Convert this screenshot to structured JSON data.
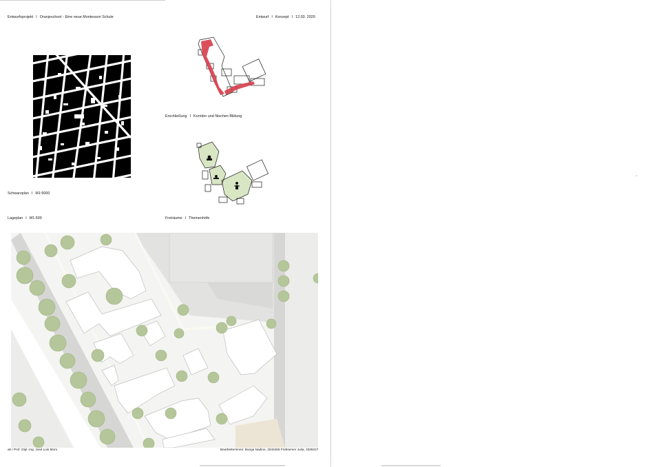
{
  "header": {
    "left": {
      "project": "Entwurfsprojekt",
      "title": "Oranjeschool - Eine neue Montessori Schule"
    },
    "right": {
      "phase": "Entwurf",
      "topic": "Konzept",
      "date": "12.03. 2020"
    },
    "separator": "I"
  },
  "captions": {
    "schwarzplan": {
      "label": "Schwarzplan",
      "scale": "M1:5000"
    },
    "erschliessung": {
      "label": "Erschließung",
      "detail": "Korridor und Nischen Bildung"
    },
    "lageplan": {
      "label": "Lageplan",
      "scale": "M1:500"
    },
    "freiraeume": {
      "label": "Freiräume",
      "detail": "Themenhöfe"
    }
  },
  "footer": {
    "left": "ak  I  Prof. Dipl.-Ing. José Luis Moro",
    "right": "Bearbeiterinnen: Bunge Nadine, 3340466   Frebsemer Julia, 3339227"
  },
  "colors": {
    "erschliessung_red": "#d9414f",
    "freiraum_green": "#d8e6c4",
    "tree_green": "#b5c79a",
    "street_grey": "#cfcfcf",
    "building_grey": "#e9e9e9"
  },
  "icons": [
    "corner-arrow-icon"
  ]
}
